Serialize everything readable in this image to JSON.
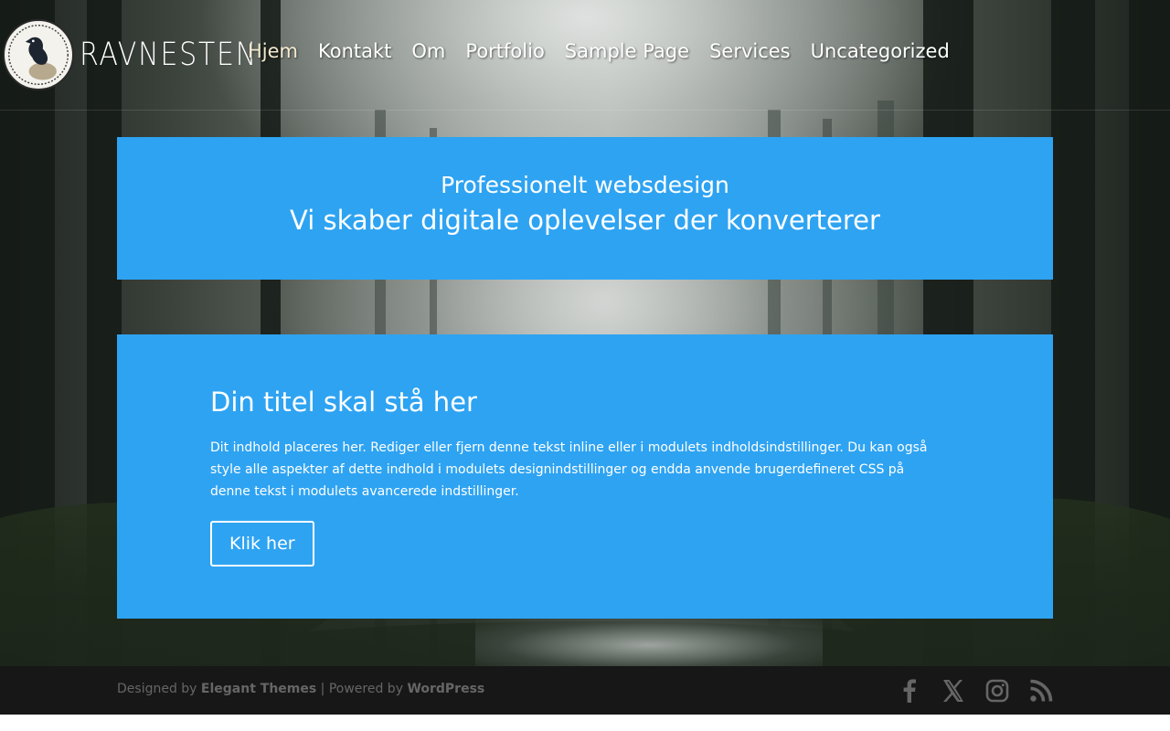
{
  "header": {
    "logo_text": "RAVNESTEN",
    "nav": [
      {
        "label": "Hjem",
        "active": true
      },
      {
        "label": "Kontakt"
      },
      {
        "label": "Om"
      },
      {
        "label": "Portfolio"
      },
      {
        "label": "Sample Page"
      },
      {
        "label": "Services"
      },
      {
        "label": "Uncategorized"
      }
    ]
  },
  "hero": {
    "subtitle": "Professionelt websdesign",
    "title": "Vi skaber digitale oplevelser der konverterer"
  },
  "content": {
    "title": "Din titel skal stå her",
    "body": "Dit indhold placeres her. Rediger eller fjern denne tekst inline eller i modulets indholdsindstillinger. Du kan også style alle aspekter af dette indhold i modulets designindstillinger og endda anvende brugerdefineret CSS på denne tekst i modulets avancerede indstillinger.",
    "button_label": "Klik her"
  },
  "footer": {
    "designed_by": "Designed by",
    "designer": "Elegant Themes",
    "separator": "| Powered by",
    "platform": "WordPress",
    "social_icons": [
      "facebook-icon",
      "x-icon",
      "instagram-icon",
      "rss-icon"
    ]
  },
  "colors": {
    "accent_blue": "#2ea3f2",
    "footer_bg": "#171717",
    "footer_text": "#666666",
    "social_icon": "#666666"
  }
}
